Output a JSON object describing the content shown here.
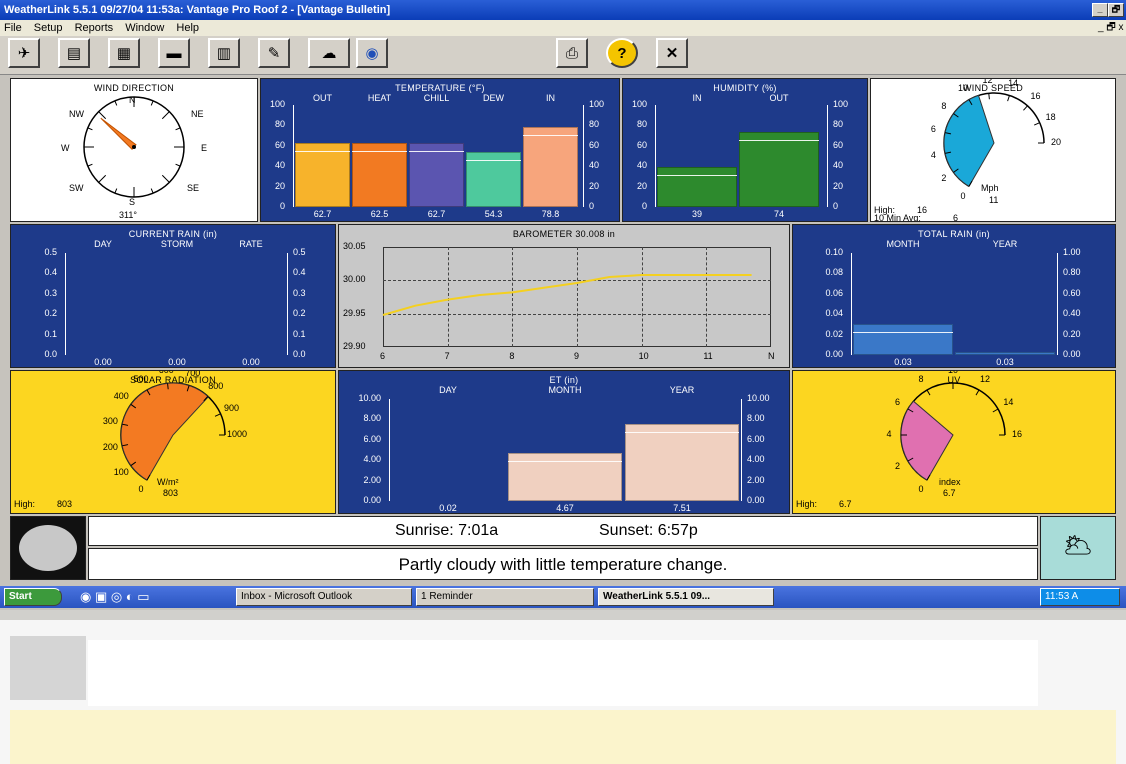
{
  "window": {
    "title": "WeatherLink 5.5.1  09/27/04  11:53a: Vantage Pro Roof 2 - [Vantage Bulletin]",
    "menu": [
      "File",
      "Setup",
      "Reports",
      "Window",
      "Help"
    ],
    "controls": {
      "minimize": "_",
      "restore": "🗗",
      "close": "x"
    }
  },
  "toolbar": {
    "icons": [
      "station-icon",
      "summary-icon",
      "bulletin-icon",
      "graph-icon",
      "strip-chart-icon",
      "notes-icon",
      "weather-cloud-icon",
      "noaa-icon",
      "print-icon",
      "help-icon",
      "exit-icon"
    ],
    "glyphs": {
      "station": "✈",
      "summary": "▤",
      "bulletin": "▦",
      "graph": "▬",
      "strip": "▥",
      "notes": "✎",
      "cloud": "☁",
      "noaa": "◉",
      "print": "⎙",
      "help": "?",
      "exit": "✕"
    }
  },
  "wind_direction": {
    "title": "WIND DIRECTION",
    "degrees_label": "311°",
    "degrees": 311,
    "points": {
      "n": "N",
      "ne": "NE",
      "e": "E",
      "se": "SE",
      "s": "S",
      "sw": "SW",
      "w": "W",
      "nw": "NW"
    }
  },
  "temperature": {
    "title": "TEMPERATURE (°F)",
    "categories": [
      "OUT",
      "HEAT",
      "CHILL",
      "DEW",
      "IN"
    ],
    "values": [
      62.7,
      62.5,
      62.7,
      54.3,
      78.8
    ],
    "labels": [
      "62.7",
      "62.5",
      "62.7",
      "54.3",
      "78.8"
    ],
    "colors": [
      "#f7b32b",
      "#f27a22",
      "#5b55b0",
      "#4ec99d",
      "#f7a57c"
    ],
    "ticks": [
      "100",
      "80",
      "60",
      "40",
      "20",
      "0"
    ],
    "ylim": [
      0,
      100
    ]
  },
  "humidity": {
    "title": "HUMIDITY (%)",
    "categories": [
      "IN",
      "OUT"
    ],
    "values": [
      39,
      74
    ],
    "labels": [
      "39",
      "74"
    ],
    "ticks": [
      "100",
      "80",
      "60",
      "40",
      "20",
      "0"
    ],
    "ylim": [
      0,
      100
    ]
  },
  "wind_speed": {
    "title": "WIND SPEED",
    "unit": "Mph",
    "value": 11,
    "value_label": "11",
    "scale": [
      "0",
      "2",
      "4",
      "6",
      "8",
      "10",
      "12",
      "14",
      "16",
      "18",
      "20"
    ],
    "high_label": "High:",
    "high": "16",
    "avg_label": "10 Min Avg:",
    "avg": "6"
  },
  "current_rain": {
    "title": "CURRENT RAIN (in)",
    "categories": [
      "DAY",
      "STORM",
      "RATE"
    ],
    "labels": [
      "0.00",
      "0.00",
      "0.00"
    ],
    "ticks": [
      "0.5",
      "0.4",
      "0.3",
      "0.2",
      "0.1",
      "0.0"
    ]
  },
  "barometer": {
    "title": "BAROMETER 30.008 in",
    "yticks": [
      "30.05",
      "30.00",
      "29.95",
      "29.90"
    ],
    "xticks": [
      "6",
      "7",
      "8",
      "9",
      "10",
      "11",
      "N"
    ]
  },
  "total_rain": {
    "title": "TOTAL RAIN (in)",
    "categories": [
      "MONTH",
      "YEAR"
    ],
    "labels": [
      "0.03",
      "0.03"
    ],
    "left_ticks": [
      "0.10",
      "0.08",
      "0.06",
      "0.04",
      "0.02",
      "0.00"
    ],
    "right_ticks": [
      "1.00",
      "0.80",
      "0.60",
      "0.40",
      "0.20",
      "0.00"
    ]
  },
  "solar": {
    "title": "SOLAR RADIATION",
    "unit": "W/m²",
    "value": 803,
    "value_label": "803",
    "scale": [
      "0",
      "100",
      "200",
      "300",
      "400",
      "500",
      "600",
      "700",
      "800",
      "900",
      "1000"
    ],
    "high_label": "High:",
    "high": "803"
  },
  "et": {
    "title": "ET (in)",
    "categories": [
      "DAY",
      "MONTH",
      "YEAR"
    ],
    "labels": [
      "0.02",
      "4.67",
      "7.51"
    ],
    "ticks": [
      "10.00",
      "8.00",
      "6.00",
      "4.00",
      "2.00",
      "0.00"
    ]
  },
  "uv": {
    "title": "UV",
    "unit": "index",
    "value": 6.7,
    "value_label": "6.7",
    "scale": [
      "0",
      "2",
      "4",
      "6",
      "8",
      "10",
      "12",
      "14",
      "16"
    ],
    "high_label": "High:",
    "high": "6.7"
  },
  "forecast": {
    "sunrise": "Sunrise:  7:01a",
    "sunset": "Sunset:  6:57p",
    "text": "Partly cloudy with little temperature change.",
    "icon": "🌥"
  },
  "taskbar": {
    "start": "Start",
    "tasks": [
      "Inbox - Microsoft Outlook",
      "1 Reminder",
      "WeatherLink 5.5.1  09..."
    ],
    "clock": "11:53 A"
  }
}
